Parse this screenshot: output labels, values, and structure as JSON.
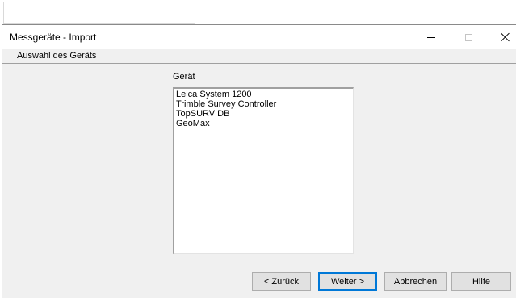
{
  "window": {
    "title": "Messgeräte - Import"
  },
  "step": {
    "label": "Auswahl des Geräts"
  },
  "device": {
    "label": "Gerät",
    "items": [
      "Leica System 1200",
      "Trimble Survey Controller",
      "TopSURV DB",
      "GeoMax"
    ]
  },
  "buttons": {
    "back": "< Zurück",
    "next": "Weiter >",
    "cancel": "Abbrechen",
    "help": "Hilfe"
  },
  "icons": {
    "minimize": "minimize-icon",
    "maximize": "maximize-icon",
    "close": "close-icon"
  },
  "colors": {
    "default_button_border": "#0078d7",
    "dialog_background": "#f0f0f0"
  }
}
